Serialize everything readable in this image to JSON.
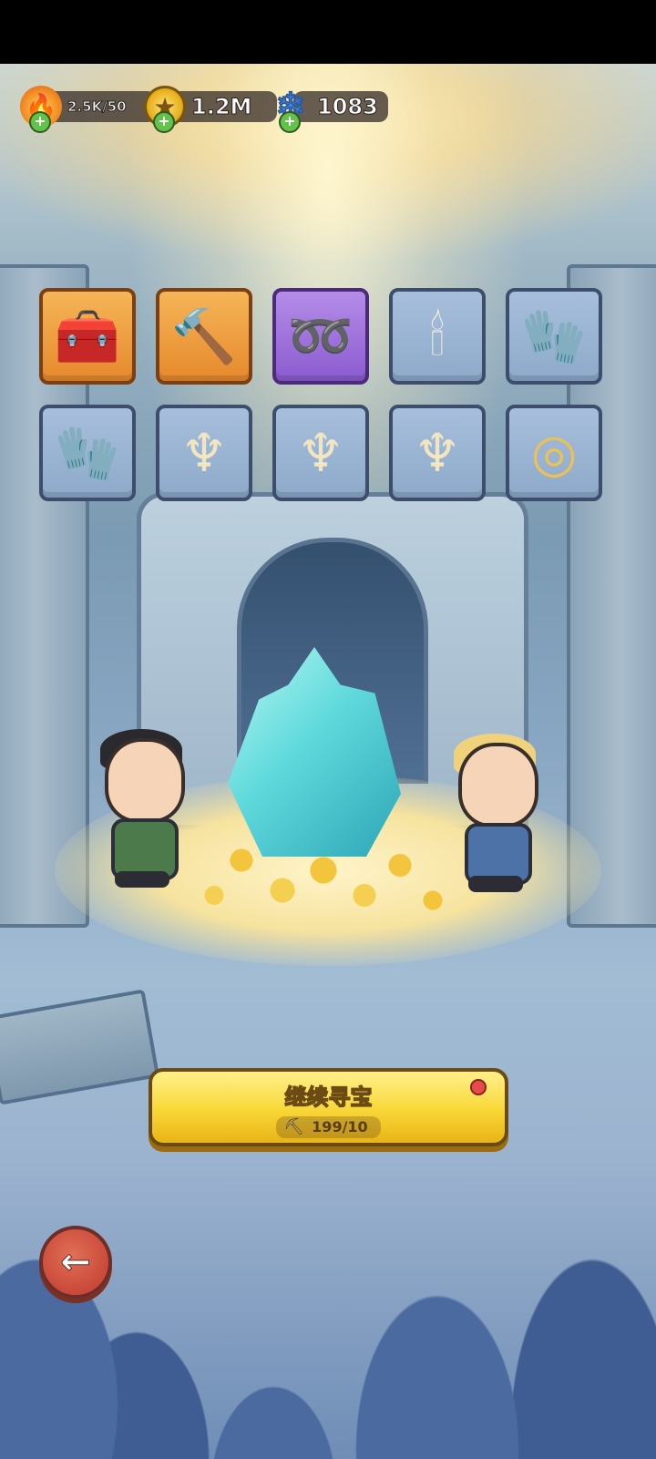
{
  "hud": {
    "energy": {
      "value": "2.5K/50",
      "icon": "flame-icon"
    },
    "gold": {
      "value": "1.2M",
      "icon": "coin-icon"
    },
    "gems": {
      "value": "1083",
      "icon": "gem-icon"
    }
  },
  "items": [
    {
      "name": "treasure-chest",
      "rarity": "orange",
      "glyph": "🧰"
    },
    {
      "name": "hammer",
      "rarity": "orange",
      "glyph": "🔨"
    },
    {
      "name": "thorn-vine",
      "rarity": "purple",
      "glyph": "➿"
    },
    {
      "name": "candle",
      "rarity": "blue",
      "glyph": "🕯"
    },
    {
      "name": "glove",
      "rarity": "blue",
      "glyph": "🧤"
    },
    {
      "name": "glove",
      "rarity": "blue",
      "glyph": "🧤"
    },
    {
      "name": "harp",
      "rarity": "blue",
      "glyph": "♆"
    },
    {
      "name": "harp",
      "rarity": "blue",
      "glyph": "♆"
    },
    {
      "name": "harp",
      "rarity": "blue",
      "glyph": "♆"
    },
    {
      "name": "mirror",
      "rarity": "blue",
      "glyph": "◎"
    }
  ],
  "continue": {
    "label": "继续寻宝",
    "cost": "199/10",
    "cost_icon": "pickaxe-icon"
  },
  "back": {
    "icon": "back-arrow-icon"
  }
}
